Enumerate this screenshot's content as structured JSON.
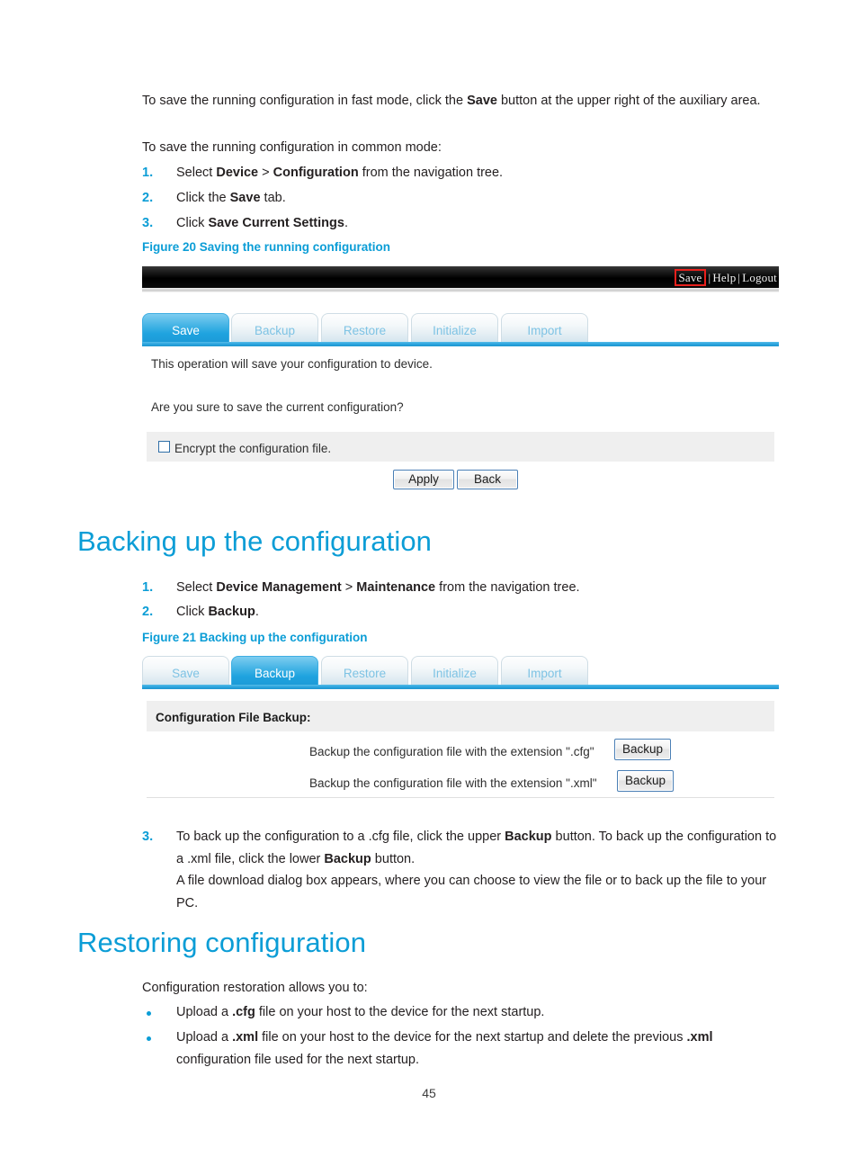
{
  "document": {
    "page_number": "45",
    "accent_color": "#0b9dd6",
    "intro": {
      "para1_pre": "To save the running configuration in fast mode, click the ",
      "para1_bold": "Save",
      "para1_post": " button at the upper right of the auxiliary area.",
      "para2": "To save the running configuration in common mode:"
    },
    "save_steps": [
      {
        "number": "1.",
        "pre": "Select ",
        "bold1": "Device",
        "mid": " > ",
        "bold2": "Configuration",
        "post": " from the navigation tree."
      },
      {
        "number": "2.",
        "pre": "Click the ",
        "bold1": "Save",
        "post": " tab."
      },
      {
        "number": "3.",
        "pre": "Click ",
        "bold1": "Save Current Settings",
        "post": "."
      }
    ],
    "figure20": {
      "caption": "Figure 20 Saving the running configuration",
      "topbar": {
        "save_link": "Save",
        "help_link": "Help",
        "logout_link": "Logout",
        "separator": "|",
        "highlight_color": "#e8201c"
      },
      "tabs": [
        {
          "label": "Save",
          "active": true
        },
        {
          "label": "Backup",
          "active": false
        },
        {
          "label": "Restore",
          "active": false
        },
        {
          "label": "Initialize",
          "active": false
        },
        {
          "label": "Import",
          "active": false
        }
      ],
      "line1": "This operation will save your configuration to device.",
      "line2": "Are you sure to save the current configuration?",
      "checkbox_label": "Encrypt the configuration file.",
      "checkbox_checked": false,
      "apply_button": "Apply",
      "back_button": "Back"
    },
    "backing_up": {
      "heading": "Backing up the configuration",
      "steps": [
        {
          "number": "1.",
          "pre": "Select ",
          "bold1": "Device Management",
          "mid": " > ",
          "bold2": "Maintenance",
          "post": " from the navigation tree."
        },
        {
          "number": "2.",
          "pre": "Click ",
          "bold1": "Backup",
          "post": "."
        }
      ],
      "figure21": {
        "caption": "Figure 21 Backing up the configuration",
        "tabs": [
          {
            "label": "Save",
            "active": false
          },
          {
            "label": "Backup",
            "active": true
          },
          {
            "label": "Restore",
            "active": false
          },
          {
            "label": "Initialize",
            "active": false
          },
          {
            "label": "Import",
            "active": false
          }
        ],
        "section_title": "Configuration File Backup:",
        "row_cfg_label": "Backup the configuration file with the extension \".cfg\"",
        "row_cfg_button": "Backup",
        "row_xml_label": "Backup the configuration file with the extension \".xml\"",
        "row_xml_button": "Backup"
      },
      "step3": {
        "number": "3.",
        "line1_pre": "To back up the configuration to a .cfg file, click the upper ",
        "line1_bold": "Backup",
        "line1_mid": " button. To back up the",
        "line2_pre": "configuration to a .xml file, click the lower ",
        "line2_bold": "Backup",
        "line2_post": " button."
      },
      "step3_note_line1": "A file download dialog box appears, where you can choose to view the file or to back up the file",
      "step3_note_line2": "to your PC."
    },
    "restoring": {
      "heading": "Restoring configuration",
      "intro": "Configuration restoration allows you to:",
      "bullets": [
        {
          "pre": "Upload a ",
          "bold1": ".cfg",
          "post": " file on your host to the device for the next startup."
        },
        {
          "pre": "Upload a ",
          "bold1": ".xml",
          "mid": " file on your host to the device for the next startup and delete the previous ",
          "bold2": ".xml",
          "post2": "configuration file used for the next startup."
        }
      ]
    }
  }
}
